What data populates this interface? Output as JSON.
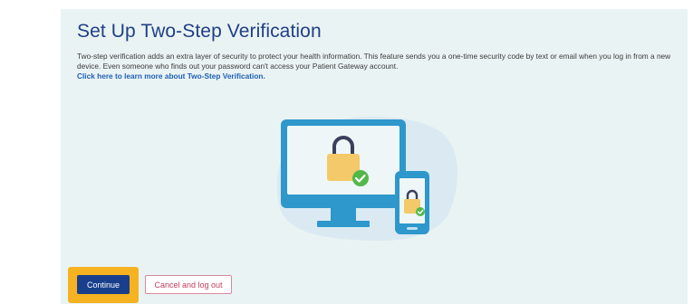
{
  "header": {
    "title": "Set Up Two-Step Verification"
  },
  "description": {
    "text": "Two-step verification adds an extra layer of security to protect your health information. This feature sends you a one-time security code by text or email when you log in from a new device. Even someone who finds out your password can't access your Patient Gateway account.",
    "learn_more_link": "Click here to learn more about Two-Step Verification."
  },
  "illustration": {
    "icons": [
      "monitor-icon",
      "padlock-icon",
      "check-badge-icon",
      "phone-icon"
    ]
  },
  "actions": {
    "continue_label": "Continue",
    "cancel_label": "Cancel and log out"
  },
  "colors": {
    "background": "#eaf3f3",
    "title": "#1f3f86",
    "link": "#1d5fb8",
    "primary_button": "#193f8c",
    "focus_highlight": "#f6b221",
    "cancel_text": "#c0405e",
    "check": "#52b848",
    "lock": "#f4c969"
  }
}
